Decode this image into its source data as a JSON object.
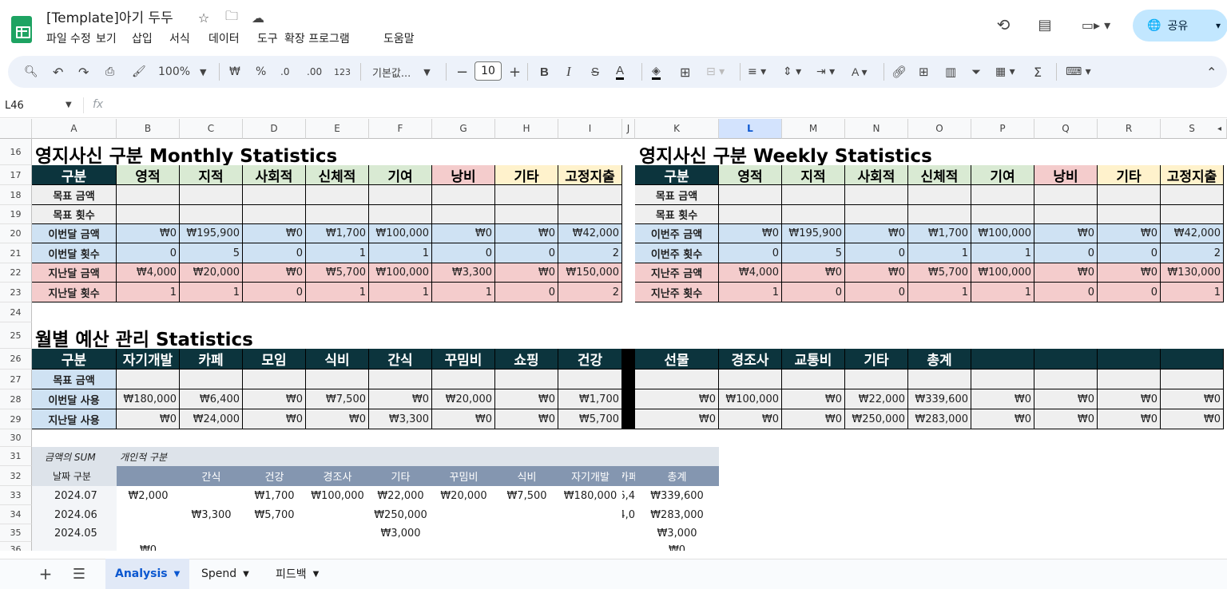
{
  "title_bar": {
    "doc_title": "[Template]아기 두두",
    "menus": [
      "파일",
      "수정",
      "보기",
      "삽입",
      "서식",
      "데이터",
      "도구",
      "확장 프로그램",
      "도움말"
    ],
    "share_label": "공유"
  },
  "toolbar": {
    "zoom": "100%",
    "currency": "₩",
    "percent": "%",
    "dec_less": ".0",
    "dec_more": ".00",
    "format_123": "123",
    "font": "기본값...",
    "font_size": "10"
  },
  "formula_bar": {
    "cell_ref": "L46",
    "fx": "fx"
  },
  "columns": [
    "A",
    "B",
    "C",
    "D",
    "E",
    "F",
    "G",
    "H",
    "I",
    "J",
    "K",
    "L",
    "M",
    "N",
    "O",
    "P",
    "Q",
    "R",
    "S"
  ],
  "rows": [
    "16",
    "17",
    "18",
    "19",
    "20",
    "21",
    "22",
    "23",
    "24",
    "25",
    "26",
    "27",
    "28",
    "29",
    "30",
    "31",
    "32",
    "33",
    "34",
    "35",
    "36"
  ],
  "monthly": {
    "title": "영지사신 구분 Monthly Statistics",
    "headers": [
      "구분",
      "영적",
      "지적",
      "사회적",
      "신체적",
      "기여",
      "낭비",
      "기타",
      "고정지출"
    ],
    "rows": [
      {
        "label": "목표 금액",
        "values": [
          "",
          "",
          "",
          "",
          "",
          "",
          "",
          ""
        ]
      },
      {
        "label": "목표 횟수",
        "values": [
          "",
          "",
          "",
          "",
          "",
          "",
          "",
          ""
        ]
      },
      {
        "label": "이번달 금액",
        "values": [
          "₩0",
          "₩195,900",
          "₩0",
          "₩1,700",
          "₩100,000",
          "₩0",
          "₩0",
          "₩42,000"
        ]
      },
      {
        "label": "이번달 횟수",
        "values": [
          "0",
          "5",
          "0",
          "1",
          "1",
          "0",
          "0",
          "2"
        ]
      },
      {
        "label": "지난달 금액",
        "values": [
          "₩4,000",
          "₩20,000",
          "₩0",
          "₩5,700",
          "₩100,000",
          "₩3,300",
          "₩0",
          "₩150,000"
        ]
      },
      {
        "label": "지난달 횟수",
        "values": [
          "1",
          "1",
          "0",
          "1",
          "1",
          "1",
          "0",
          "2"
        ]
      }
    ]
  },
  "weekly": {
    "title": "영지사신 구분 Weekly Statistics",
    "headers": [
      "구분",
      "영적",
      "지적",
      "사회적",
      "신체적",
      "기여",
      "낭비",
      "기타",
      "고정지출"
    ],
    "rows": [
      {
        "label": "목표 금액",
        "values": [
          "",
          "",
          "",
          "",
          "",
          "",
          "",
          ""
        ]
      },
      {
        "label": "목표 횟수",
        "values": [
          "",
          "",
          "",
          "",
          "",
          "",
          "",
          ""
        ]
      },
      {
        "label": "이번주 금액",
        "values": [
          "₩0",
          "₩195,900",
          "₩0",
          "₩1,700",
          "₩100,000",
          "₩0",
          "₩0",
          "₩42,000"
        ]
      },
      {
        "label": "이번주 횟수",
        "values": [
          "0",
          "5",
          "0",
          "1",
          "1",
          "0",
          "0",
          "2"
        ]
      },
      {
        "label": "지난주 금액",
        "values": [
          "₩4,000",
          "₩0",
          "₩0",
          "₩5,700",
          "₩100,000",
          "₩0",
          "₩0",
          "₩130,000"
        ]
      },
      {
        "label": "지난주 횟수",
        "values": [
          "1",
          "0",
          "0",
          "1",
          "1",
          "0",
          "0",
          "1"
        ]
      }
    ]
  },
  "budget": {
    "title": "월별 예산 관리 Statistics",
    "headers": [
      "구분",
      "자기개발",
      "카페",
      "모임",
      "식비",
      "간식",
      "꾸밈비",
      "쇼핑",
      "건강",
      "",
      "선물",
      "경조사",
      "교통비",
      "기타",
      "총계",
      "",
      "",
      "",
      ""
    ],
    "rows": [
      {
        "label": "목표 금액",
        "values": [
          "",
          "",
          "",
          "",
          "",
          "",
          "",
          "",
          "",
          "",
          "",
          "",
          "",
          "",
          "",
          "",
          "",
          ""
        ]
      },
      {
        "label": "이번달 사용",
        "values": [
          "₩180,000",
          "₩6,400",
          "₩0",
          "₩7,500",
          "₩0",
          "₩20,000",
          "₩0",
          "₩1,700",
          "",
          "₩0",
          "₩100,000",
          "₩0",
          "₩22,000",
          "₩339,600",
          "₩0",
          "₩0",
          "₩0",
          "₩0"
        ]
      },
      {
        "label": "지난달 사용",
        "values": [
          "₩0",
          "₩24,000",
          "₩0",
          "₩0",
          "₩3,300",
          "₩0",
          "₩0",
          "₩5,700",
          "",
          "₩0",
          "₩0",
          "₩0",
          "₩250,000",
          "₩283,000",
          "₩0",
          "₩0",
          "₩0",
          "₩0"
        ]
      }
    ]
  },
  "pivot": {
    "sum_label": "금액의 SUM",
    "group_label": "개인적 구분",
    "row_label": "날짜 구분",
    "headers": [
      "",
      "간식",
      "건강",
      "경조사",
      "기타",
      "꾸밈비",
      "식비",
      "자기개발",
      "카페",
      "총계"
    ],
    "rows": [
      {
        "date": "2024.07",
        "values": [
          "₩2,000",
          "",
          "₩1,700",
          "₩100,000",
          "₩22,000",
          "₩20,000",
          "₩7,500",
          "₩180,000",
          "6,4",
          "₩339,600"
        ]
      },
      {
        "date": "2024.06",
        "values": [
          "",
          "₩3,300",
          "₩5,700",
          "",
          "₩250,000",
          "",
          "",
          "",
          "4,0",
          "₩283,000"
        ]
      },
      {
        "date": "2024.05",
        "values": [
          "",
          "",
          "",
          "",
          "₩3,000",
          "",
          "",
          "",
          "",
          "₩3,000"
        ]
      },
      {
        "date": "",
        "values": [
          "₩0",
          "",
          "",
          "",
          "",
          "",
          "",
          "",
          "",
          "₩0"
        ]
      }
    ]
  },
  "sheet_tabs": [
    "Analysis",
    "Spend",
    "피드백"
  ],
  "colors": {
    "header_dark": "#0c343d",
    "green": "#d9ead3",
    "red": "#f4cccc",
    "yellow": "#fff2cc",
    "blue": "#cfe2f3",
    "gray": "#efefef",
    "pivot_header": "#8496b0",
    "pivot_top": "#dde3ea"
  }
}
